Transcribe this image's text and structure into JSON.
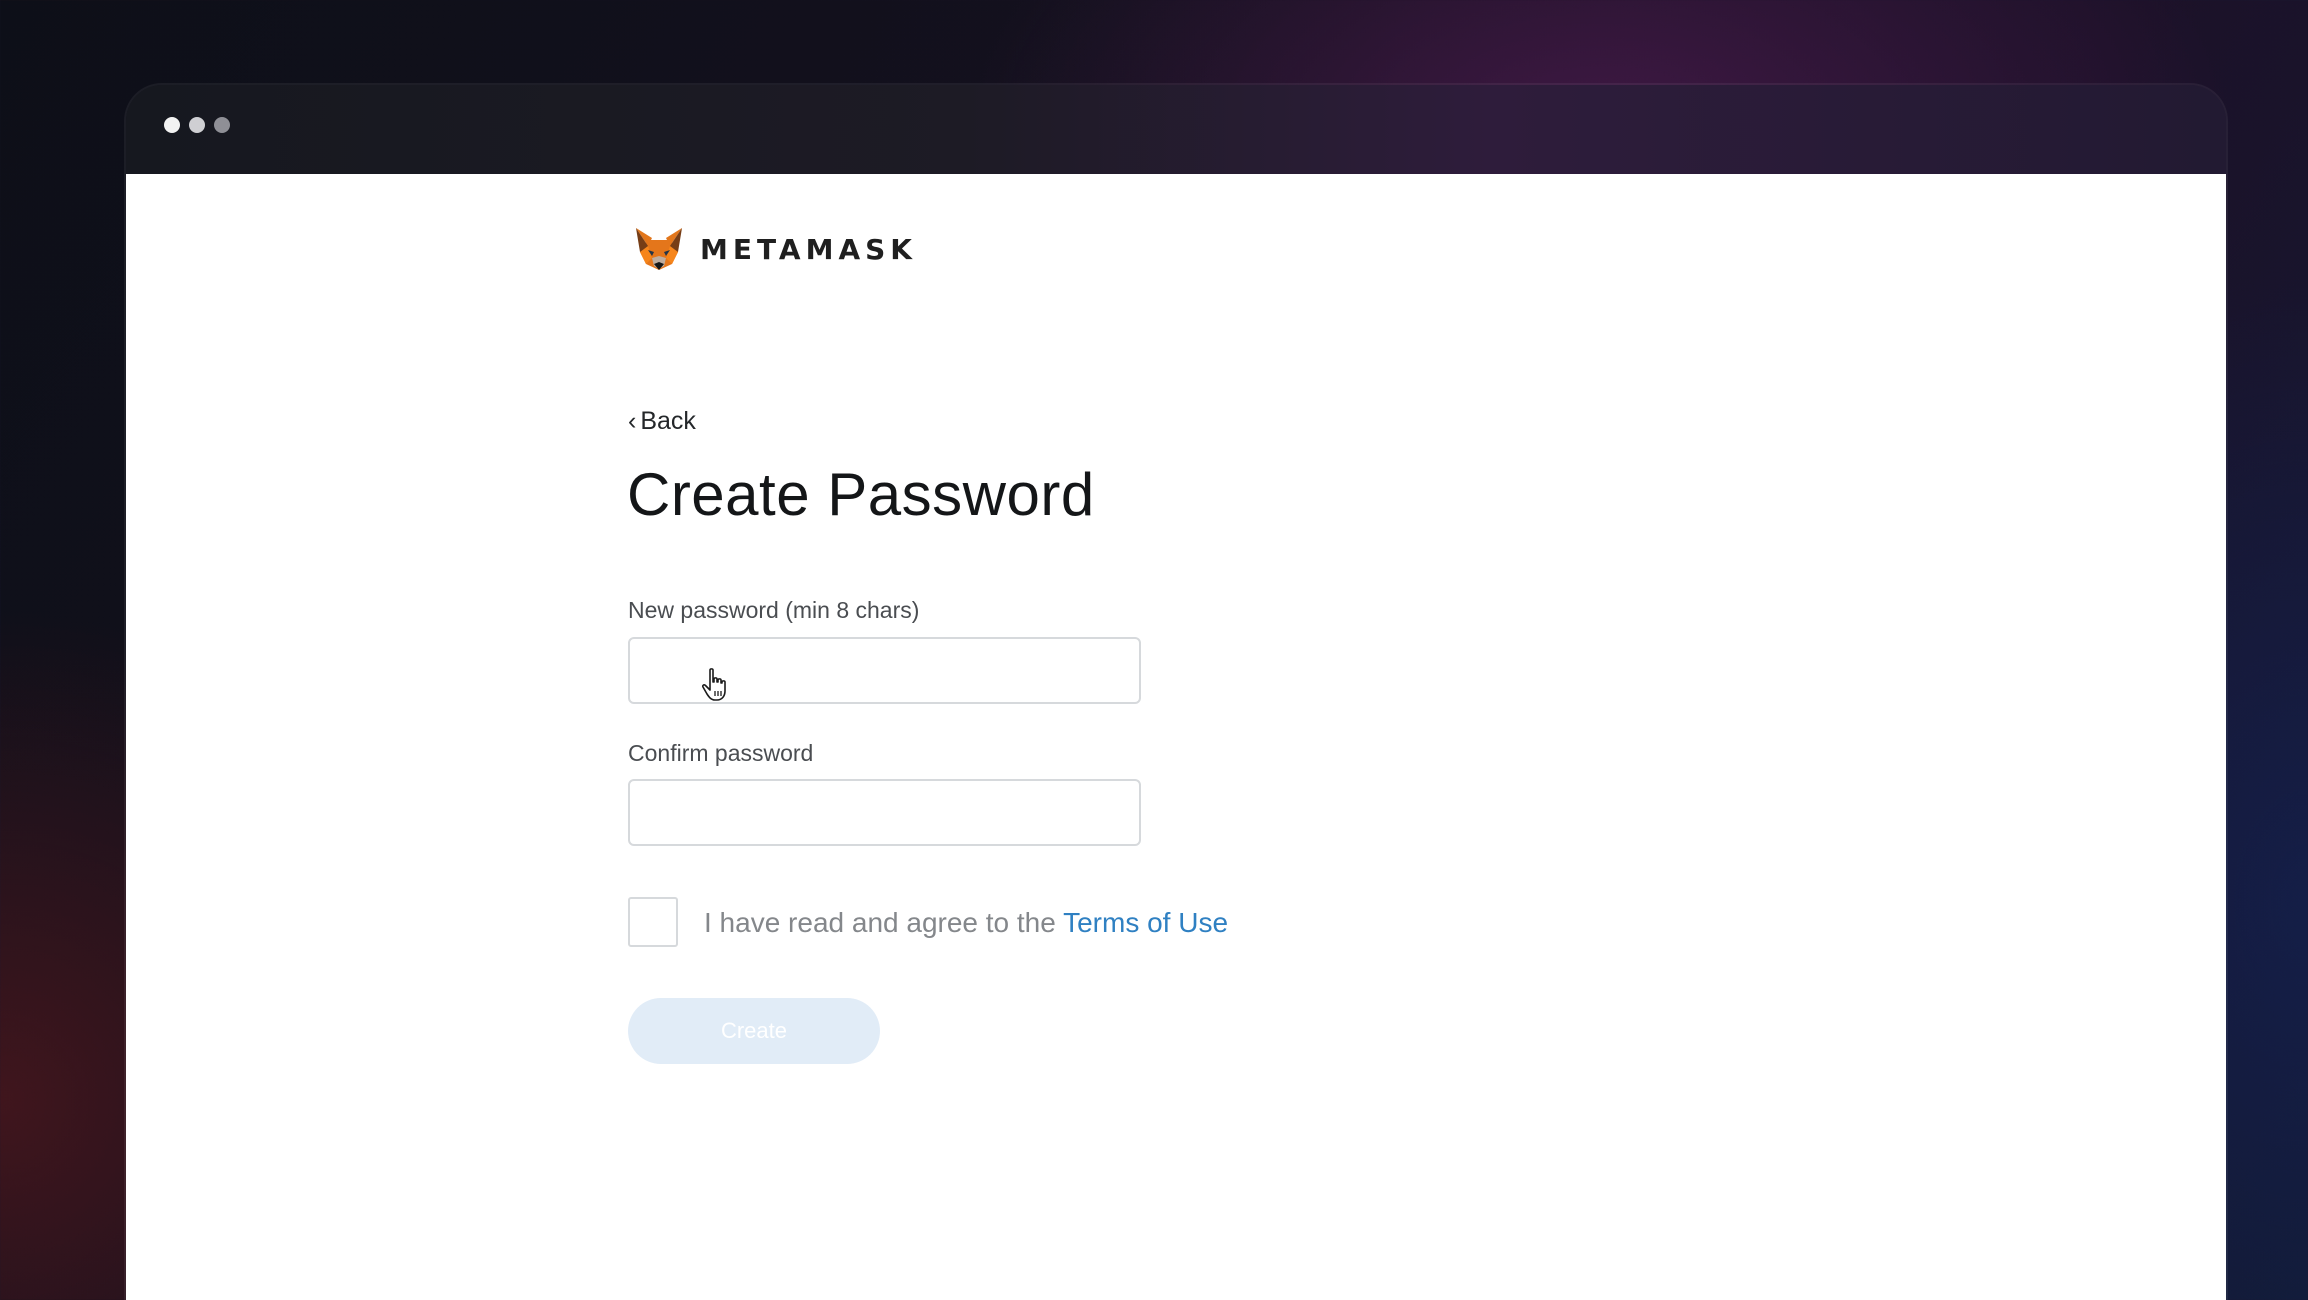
{
  "brand": {
    "name": "METAMASK",
    "logo_icon": "metamask-fox-icon"
  },
  "nav": {
    "back_chevron": "‹",
    "back_label": "Back"
  },
  "page": {
    "title": "Create Password"
  },
  "form": {
    "new_password_label": "New password (min 8 chars)",
    "new_password_value": "",
    "confirm_password_label": "Confirm password",
    "confirm_password_value": "",
    "terms_checked": false,
    "agree_text": "I have read and agree to the",
    "terms_link": "Terms of Use",
    "create_button": "Create",
    "create_button_disabled": true
  },
  "colors": {
    "link": "#2f80c2",
    "button_disabled_bg": "#e1ecf7",
    "window_titlebar": "#1d1b25"
  }
}
